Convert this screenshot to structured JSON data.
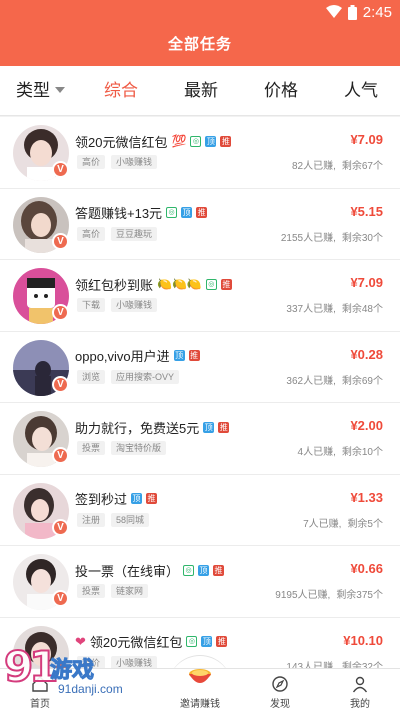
{
  "status_bar": {
    "time": "2:45"
  },
  "header": {
    "title": "全部任务"
  },
  "filters": [
    {
      "label": "类型",
      "has_dropdown": true,
      "active": false
    },
    {
      "label": "综合",
      "active": true
    },
    {
      "label": "最新",
      "active": false
    },
    {
      "label": "价格",
      "active": false
    },
    {
      "label": "人气",
      "active": false
    }
  ],
  "badge_label": "V",
  "tag_labels": {
    "shield": "◎",
    "ding": "顶",
    "tui": "推"
  },
  "tasks": [
    {
      "title": "领20元微信红包",
      "emoji": "💯",
      "price": "¥7.09",
      "chips": [
        "高价",
        "小喙赚钱"
      ],
      "earned": "82人已赚,",
      "remaining": "剩余67个"
    },
    {
      "title": "答题赚钱+13元",
      "emoji": "",
      "price": "¥5.15",
      "chips": [
        "高价",
        "豆豆趣玩"
      ],
      "earned": "2155人已赚,",
      "remaining": "剩余30个"
    },
    {
      "title": "领红包秒到账",
      "emoji": "🍋🍋🍋",
      "price": "¥7.09",
      "chips": [
        "下载",
        "小喙赚钱"
      ],
      "earned": "337人已赚,",
      "remaining": "剩余48个"
    },
    {
      "title": "oppo,vivo用户进",
      "emoji": "",
      "price": "¥0.28",
      "chips": [
        "浏览",
        "应用搜索-OVY"
      ],
      "earned": "362人已赚,",
      "remaining": "剩余69个"
    },
    {
      "title": "助力就行，免费送5元",
      "emoji": "",
      "price": "¥2.00",
      "chips": [
        "投票",
        "淘宝特价版"
      ],
      "earned": "4人已赚,",
      "remaining": "剩余10个"
    },
    {
      "title": "签到秒过",
      "emoji": "",
      "price": "¥1.33",
      "chips": [
        "注册",
        "58同城"
      ],
      "earned": "7人已赚,",
      "remaining": "剩余5个"
    },
    {
      "title": "投一票（在线审）",
      "emoji": "",
      "price": "¥0.66",
      "chips": [
        "投票",
        "链家网"
      ],
      "earned": "9195人已赚,",
      "remaining": "剩余375个"
    },
    {
      "title": "领20元微信红包",
      "emoji": "❤",
      "price": "¥10.10",
      "chips": [
        "高价",
        "小喙赚钱"
      ],
      "earned": "143人已赚,",
      "remaining": "剩余32个"
    }
  ],
  "bottom_nav": [
    {
      "label": "首页",
      "icon": "home-icon"
    },
    {
      "label": "邀请赚钱",
      "icon": "invite-pot-icon"
    },
    {
      "label": "发现",
      "icon": "compass-icon"
    },
    {
      "label": "我的",
      "icon": "person-icon"
    }
  ],
  "watermark": {
    "logo": "91",
    "text": "游戏",
    "url": "91danji.com"
  },
  "colors": {
    "brand": "#f5674b",
    "price": "#ef4a3a",
    "active_filter": "#ef5a44"
  }
}
